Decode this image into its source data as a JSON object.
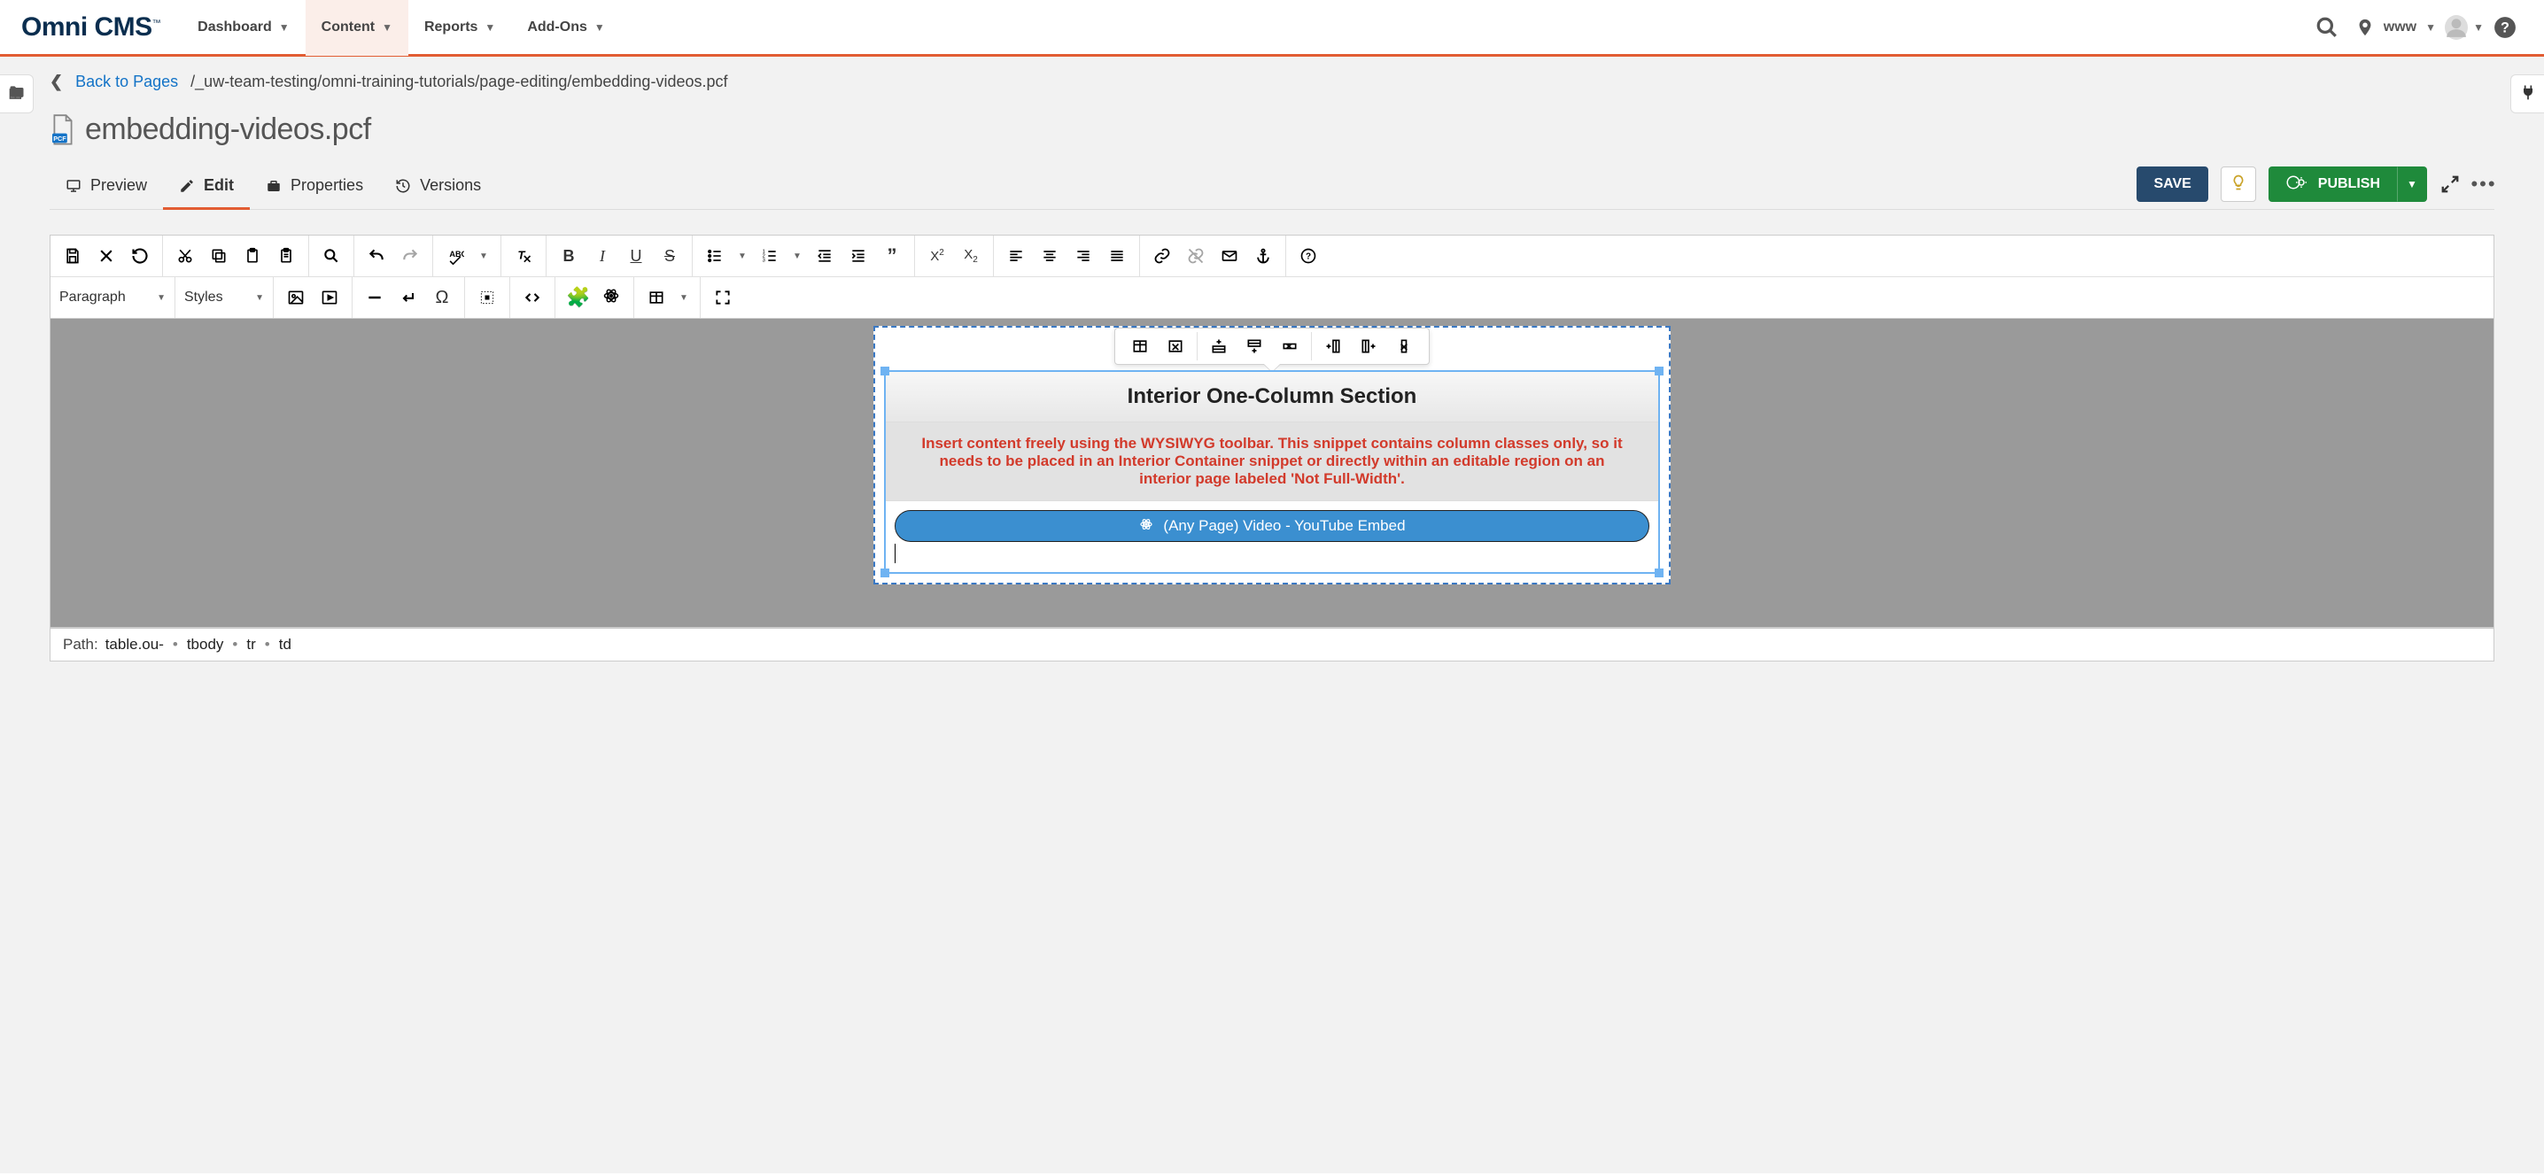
{
  "nav": {
    "logo": "Omni CMS",
    "items": [
      {
        "label": "Dashboard",
        "active": false
      },
      {
        "label": "Content",
        "active": true
      },
      {
        "label": "Reports",
        "active": false
      },
      {
        "label": "Add-Ons",
        "active": false
      }
    ],
    "domain": "www"
  },
  "breadcrumb": {
    "back_label": "Back to Pages",
    "path": "/_uw-team-testing/omni-training-tutorials/page-editing/embedding-videos.pcf"
  },
  "file": {
    "name": "embedding-videos.pcf"
  },
  "tabs": [
    {
      "id": "preview",
      "label": "Preview",
      "active": false
    },
    {
      "id": "edit",
      "label": "Edit",
      "active": true
    },
    {
      "id": "properties",
      "label": "Properties",
      "active": false
    },
    {
      "id": "versions",
      "label": "Versions",
      "active": false
    }
  ],
  "actions": {
    "save": "SAVE",
    "publish": "PUBLISH"
  },
  "toolbar": {
    "paragraph_select": "Paragraph",
    "styles_select": "Styles"
  },
  "editor": {
    "snippet_title": "Interior One-Column Section",
    "snippet_note": "Insert content freely using the WYSIWYG toolbar. This snippet contains column classes only, so it needs to be placed in an Interior Container snippet or directly within an editable region on an interior page labeled 'Not Full-Width'.",
    "component_label": "(Any Page) Video - YouTube Embed"
  },
  "status_path": {
    "label": "Path:",
    "segments": [
      "table.ou-",
      "tbody",
      "tr",
      "td"
    ]
  }
}
